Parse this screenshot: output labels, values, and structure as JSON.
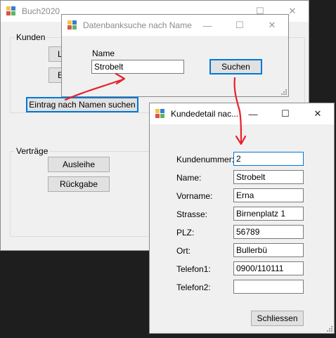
{
  "main": {
    "title": "Buch2020",
    "customers_group": "Kunden",
    "btn_partial_1": "Li",
    "btn_partial_2": "E",
    "btn_search_by_name": "Eintrag nach Namen suchen",
    "contracts_group": "Verträge",
    "btn_loan": "Ausleihe",
    "btn_return": "Rückgabe"
  },
  "search_dialog": {
    "title": "Datenbanksuche nach Name",
    "name_label": "Name",
    "name_value": "Strobelt",
    "search_button": "Suchen"
  },
  "detail_dialog": {
    "title": "Kundedetail nac...",
    "fields": [
      {
        "label": "Kundenummer:",
        "value": "2"
      },
      {
        "label": "Name:",
        "value": "Strobelt"
      },
      {
        "label": "Vorname:",
        "value": "Erna"
      },
      {
        "label": "Strasse:",
        "value": "Birnenplatz 1"
      },
      {
        "label": "PLZ:",
        "value": "56789"
      },
      {
        "label": "Ort:",
        "value": "Bullerbü"
      },
      {
        "label": "Telefon1:",
        "value": "0900/110111"
      },
      {
        "label": "Telefon2:",
        "value": ""
      }
    ],
    "close_button": "Schliessen"
  },
  "caption_glyphs": {
    "minimize": "—",
    "maximize": "☐",
    "close": "✕"
  },
  "colors": {
    "focus": "#0078d7",
    "annotation_arrow": "#e8202a",
    "desktop": "#1e1e1e"
  }
}
